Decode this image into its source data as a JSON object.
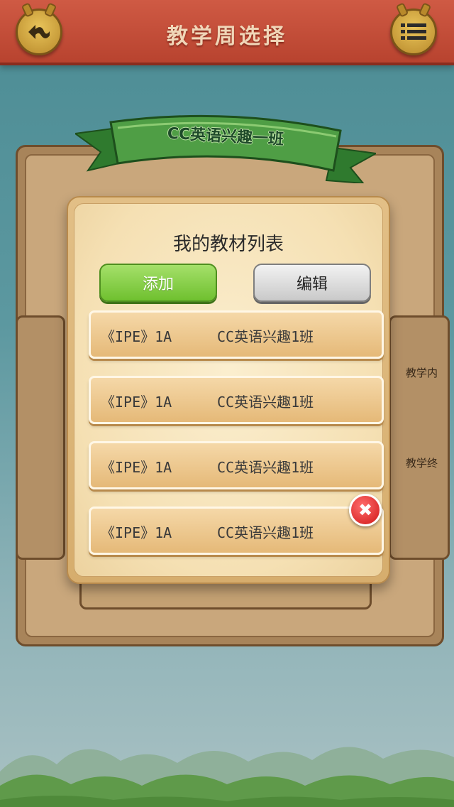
{
  "header": {
    "title": "教学周选择",
    "back_icon": "back-arrow-icon",
    "menu_icon": "menu-list-icon"
  },
  "class_banner": {
    "title": "CC英语兴趣一班"
  },
  "background_panel": {
    "right_labels": [
      "教学内",
      "教学终"
    ]
  },
  "dialog": {
    "title": "我的教材列表",
    "add_label": "添加",
    "edit_label": "编辑",
    "items": [
      {
        "code": "《IPE》1A",
        "class": "CC英语兴趣1班"
      },
      {
        "code": "《IPE》1A",
        "class": "CC英语兴趣1班"
      },
      {
        "code": "《IPE》1A",
        "class": "CC英语兴趣1班"
      },
      {
        "code": "《IPE》1A",
        "class": "CC英语兴趣1班"
      }
    ],
    "delete_icon": "close-icon"
  },
  "colors": {
    "header": "#c04a35",
    "add_button": "#7ccc3a",
    "edit_button": "#d9d9d9",
    "delete": "#e02020",
    "ribbon": "#3f8f3a"
  }
}
